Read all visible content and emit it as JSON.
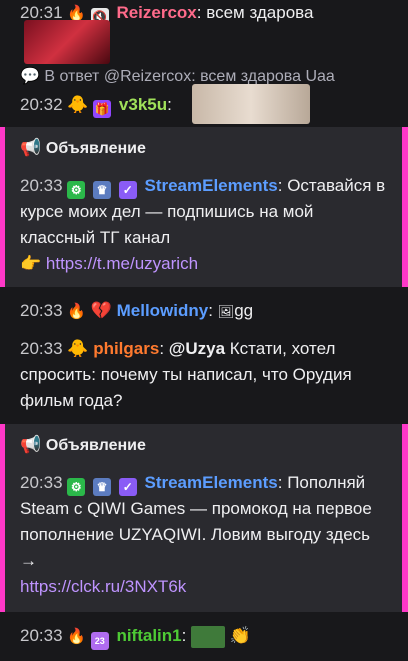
{
  "messages": {
    "m1": {
      "time": "20:31",
      "user": "Reizercox",
      "text": "всем здарова",
      "user_color": "#ff6b8b"
    },
    "reply": {
      "text": "В ответ @Reizercox: всем здарова Uaa"
    },
    "m2": {
      "time": "20:32",
      "user": "v3k5u",
      "user_color": "#a0e05a"
    },
    "m3": {
      "time": "20:33",
      "user": "Mellowidny",
      "user_color": "#5c9dff",
      "emote_alt": "gg"
    },
    "m4": {
      "time": "20:33",
      "user": "philgars",
      "user_color": "#ff7a2f",
      "mention": "@Uzya",
      "text": "Кстати, хотел спросить: почему ты написал, что Орудия фильм года?"
    },
    "m5": {
      "time": "20:33",
      "user": "niftalin1",
      "user_color": "#4ecb35"
    }
  },
  "announcements": [
    {
      "title": "Объявление",
      "time": "20:33",
      "user": "StreamElements",
      "text": "Оставайся в курсе моих дел — подпишись на мой классный ТГ канал",
      "link": "https://t.me/uzyarich"
    },
    {
      "title": "Объявление",
      "time": "20:33",
      "user": "StreamElements",
      "text": "Пополняй Steam с QIWI Games — промокод на первое пополнение UZYAQIWI. Ловим выгоду здесь →",
      "link": "https://clck.ru/3NXT6k"
    }
  ],
  "colors": {
    "accent": "#ff38c8",
    "link": "#bf94ff",
    "streamelements": "#5c9dff"
  }
}
